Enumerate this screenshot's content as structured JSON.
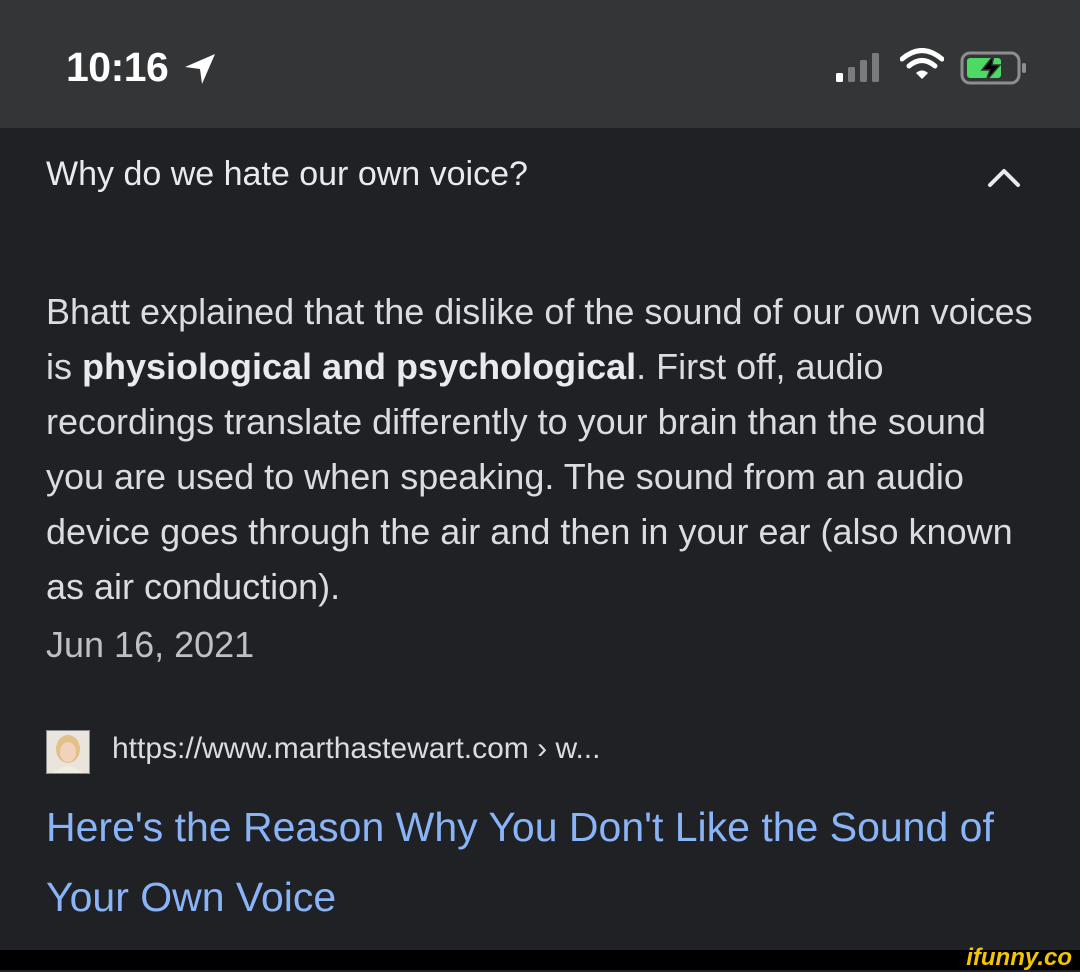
{
  "status_bar": {
    "time": "10:16",
    "icons": [
      "location-arrow-icon",
      "cellular-signal-icon",
      "wifi-icon",
      "battery-charging-icon"
    ],
    "battery_color": "#4cd964"
  },
  "result": {
    "question": "Why do we hate our own voice?",
    "answer_part1": "Bhatt explained that the dislike of the sound of our own voices is ",
    "answer_bold": "physiological and psychological",
    "answer_part2": ". First off, audio recordings translate differently to your brain than the sound you are used to when speaking. The sound from an audio device goes through the air and then in your ear (also known as air conduction).",
    "date": "Jun 16, 2021",
    "source_url": "https://www.marthastewart.com › w...",
    "link_title": "Here's the Reason Why You Don't Like the Sound of Your Own Voice",
    "link_color": "#8ab4f8"
  },
  "watermark": "ifunny.co"
}
